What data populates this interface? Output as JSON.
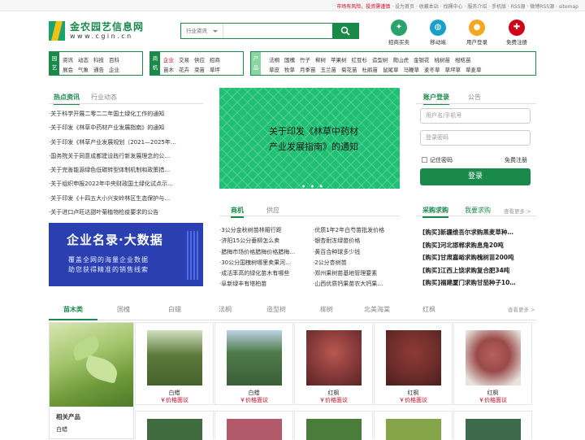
{
  "topbar": {
    "risk": "市场有风险，投资需谨慎",
    "links": [
      "设为首页",
      "收藏本站",
      "找桶中心",
      "服务介绍",
      "手机版",
      "RSS源",
      "微博RSS源",
      "sitemap"
    ]
  },
  "logo": {
    "name": "金农园艺信息网",
    "url": "www.cgin.cn"
  },
  "search": {
    "category": "行业资讯",
    "placeholder": ""
  },
  "quick_links": [
    {
      "label": "招商买卖",
      "icon": "handshake-icon",
      "color": "#2aa26a",
      "glyph": "✦"
    },
    {
      "label": "移动端",
      "icon": "globe-icon",
      "color": "#1aa0c8",
      "glyph": "◍"
    },
    {
      "label": "用户登录",
      "icon": "user-icon",
      "color": "#f5a623",
      "glyph": "●"
    },
    {
      "label": "免费注册",
      "icon": "register-icon",
      "color": "#d0021b",
      "glyph": "✚"
    }
  ],
  "nav": {
    "garden": {
      "tag": "园艺",
      "row1": [
        "资讯",
        "动态",
        "科技",
        "百科"
      ],
      "row2": [
        "展会",
        "气象",
        "通告",
        "企业"
      ]
    },
    "business": {
      "tag": "商机",
      "row1": [
        "企业",
        "交易",
        "供应",
        "招商"
      ],
      "row2": [
        "苗木",
        "花卉",
        "菜苗",
        "草坪"
      ]
    },
    "products": {
      "tag": "产品",
      "row1": [
        "法桐",
        "国槐",
        "竹子",
        "柳树",
        "苹果树",
        "红豆杉",
        "造型树",
        "爬山虎",
        "金银花",
        "桃树苗",
        "柑桔苗"
      ],
      "row2": [
        "草皮",
        "牧草",
        "月季苗",
        "玉兰苗",
        "菊花苗",
        "杜鹃苗",
        "鼠尾草",
        "马鞭草",
        "麦冬草",
        "草坪草",
        "草麦草"
      ]
    }
  },
  "news": {
    "tab_active": "热点资讯",
    "tab_other": "行业动态",
    "items": [
      "·关于科学开展二零二二年国土绿化工作的通知",
      "·关于印发《林草中药材产业发展指南》的通知",
      "·关于印发《林草产业发展规划（2021—2025年…",
      "·国务院关于同意成都建设践行新发展理念的公…",
      "·关于完善能源绿色低碳转型体制机制和政策措…",
      "·关于组织申报2022年中央财政国土绿化试点示…",
      "·关于印发《十四五大小兴安岭林区生态保护与…",
      "·关于进口卢旺达甜叶菊植物检疫要求的公告"
    ]
  },
  "banner": {
    "line1": "关于印发《林草中药材",
    "line2": "产业发展指南》的通知",
    "dots": "● ● ●"
  },
  "ad": {
    "big": "企业名录·大数据",
    "small1": "覆盖全网的海量企业数据",
    "small2": "助您获得精准的销售线索"
  },
  "business": {
    "tab_active": "商机",
    "tab_other": "供应",
    "col1": [
      "·3公分金秋树苗林厢行距",
      "·济阳15公分垂柳怎么卖",
      "·腊梅市场价格腊梅价格腊梅…",
      "·30公分国槐树哪里卖果河…",
      "·成活率高的绿化苗木有哪些",
      "·阜新绿丰有塔柏苗"
    ],
    "col2": [
      "·优质1年2年白芍苗批发价格",
      "·银杏耐冻绿苗价格",
      "·黄百合种球多少钱",
      "·2公分杏树苗",
      "·郑州果树苗基地管理要素",
      "·山西优质钙果苗农大钙果…"
    ]
  },
  "login": {
    "tab_active": "账户登录",
    "tab_other": "公告",
    "user_placeholder": "用户名/手机号",
    "pass_placeholder": "登录密码",
    "remember": "记住密码",
    "register": "免费注册",
    "button": "登录"
  },
  "purchase": {
    "tab_active": "采购求购",
    "tab_other": "我要求购",
    "more": "查看更多 >",
    "items": [
      "[购买]新疆维吾尔求购黑麦草种…",
      "[购买]河北邯郸求购息角20吨",
      "[购买]甘肃嘉峪求购槐树苗200吨",
      "[购买]江西上饶求购复合肥34吨",
      "[购买]福建厦门求购甘茄种子10…"
    ]
  },
  "categories": {
    "active": "苗木类",
    "items": [
      "国槐",
      "白蜡",
      "法桐",
      "造型树",
      "柳树",
      "北美海棠",
      "红枫"
    ],
    "more": "查看更多 >"
  },
  "related": {
    "title": "相关产品",
    "item": "白蜡"
  },
  "products": [
    {
      "name": "白蜡",
      "price": "￥价格面议",
      "color": "#5d7a3c"
    },
    {
      "name": "白蜡",
      "price": "￥价格面议",
      "color": "#4e7c4a"
    },
    {
      "name": "红枫",
      "price": "￥价格面议",
      "color": "#8a3b3b"
    },
    {
      "name": "红枫",
      "price": "￥价格面议",
      "color": "#6e2d2a"
    },
    {
      "name": "红枫",
      "price": "￥价格面议",
      "color": "#9a4a4a"
    }
  ],
  "products_row2_colors": [
    "#3f6b3f",
    "#b35a6a",
    "#4a7d3a",
    "#86a54a",
    "#3d6a4a"
  ]
}
